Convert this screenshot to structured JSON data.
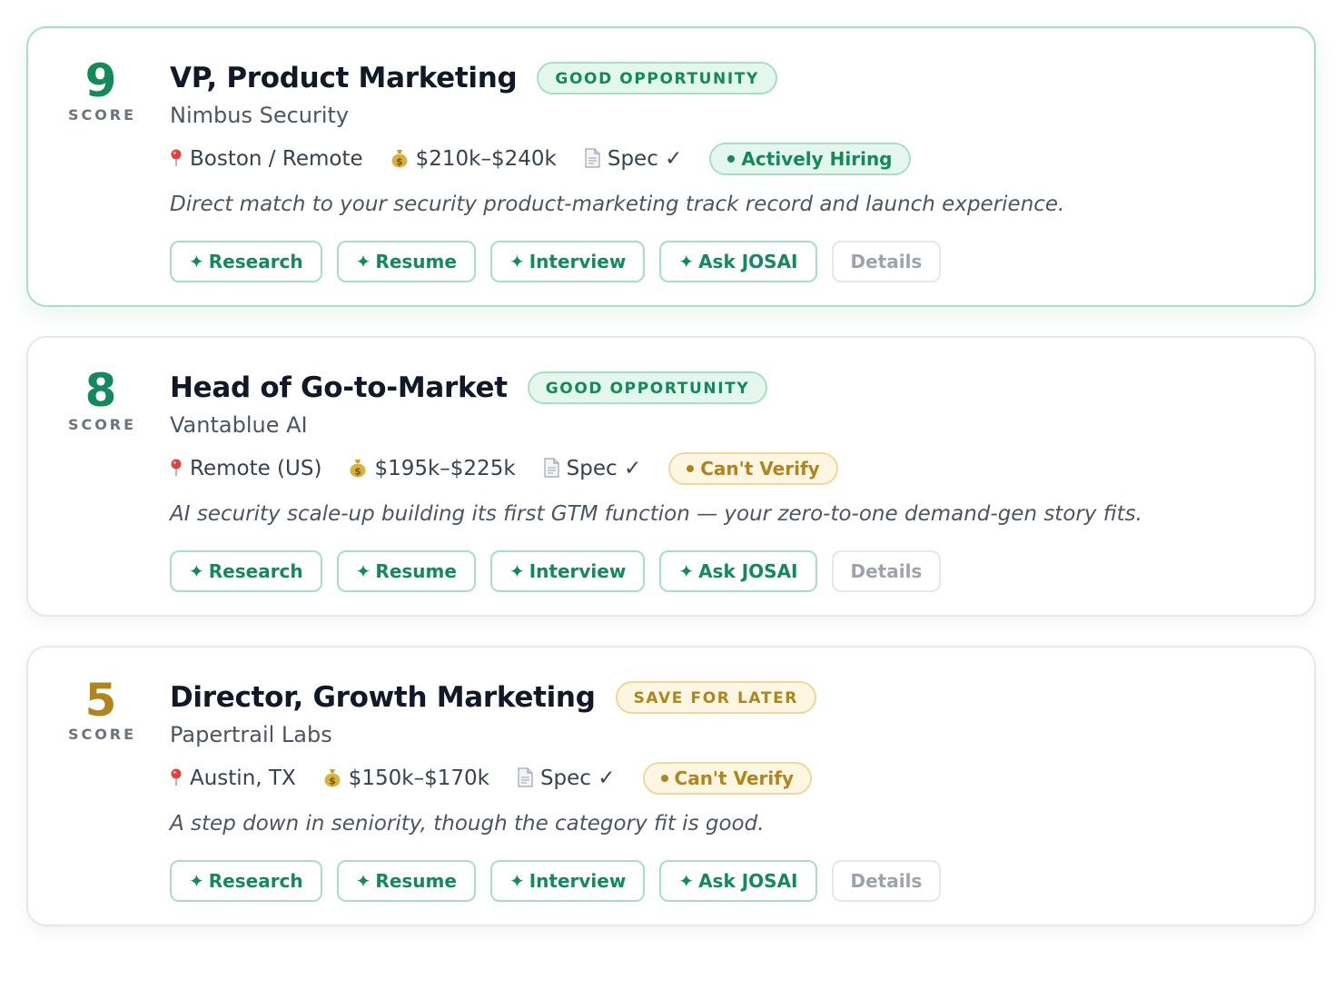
{
  "score_label": "SCORE",
  "actions": {
    "research": "Research",
    "resume": "Resume",
    "interview": "Interview",
    "ask": "Ask JOSAI",
    "details": "Details"
  },
  "colors": {
    "good": "#138a5b",
    "save": "#b0861c",
    "border_featured": "#a7dfc5",
    "border_default": "#e5e7eb"
  },
  "jobs": [
    {
      "score": "9",
      "score_tier": "good",
      "featured": true,
      "title": "VP, Product Marketing",
      "rating": "GOOD OPPORTUNITY",
      "rating_tier": "good",
      "company": "Nimbus Security",
      "location_icon": "pin-icon",
      "location": "Boston / Remote",
      "salary_icon": "money-bag-icon",
      "salary": "$210k–$240k",
      "spec_icon": "document-icon",
      "spec": "Spec ✓",
      "status": "Actively Hiring",
      "status_tier": "ok",
      "summary": "Direct match to your security product-marketing track record and launch experience."
    },
    {
      "score": "8",
      "score_tier": "good",
      "featured": false,
      "title": "Head of Go-to-Market",
      "rating": "GOOD OPPORTUNITY",
      "rating_tier": "good",
      "company": "Vantablue AI",
      "location_icon": "pin-icon",
      "location": "Remote (US)",
      "salary_icon": "money-bag-icon",
      "salary": "$195k–$225k",
      "spec_icon": "document-icon",
      "spec": "Spec ✓",
      "status": "Can't Verify",
      "status_tier": "warn",
      "summary": "AI security scale-up building its first GTM function — your zero-to-one demand-gen story fits."
    },
    {
      "score": "5",
      "score_tier": "save",
      "featured": false,
      "title": "Director, Growth Marketing",
      "rating": "SAVE FOR LATER",
      "rating_tier": "save",
      "company": "Papertrail Labs",
      "location_icon": "pin-icon",
      "location": "Austin, TX",
      "salary_icon": "money-bag-icon",
      "salary": "$150k–$170k",
      "spec_icon": "document-icon",
      "spec": "Spec ✓",
      "status": "Can't Verify",
      "status_tier": "warn",
      "summary": "A step down in seniority, though the category fit is good."
    }
  ]
}
